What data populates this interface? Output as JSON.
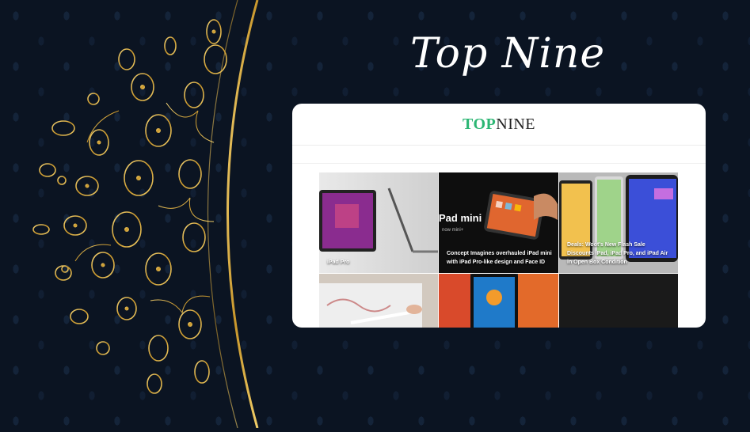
{
  "header": {
    "title": "Top Nine"
  },
  "site": {
    "logo_part1": "TOP",
    "logo_part2": "NINE"
  },
  "tiles": [
    {
      "caption": "iPad Pro",
      "bg": "#d9d9d9"
    },
    {
      "caption": "Concept Imagines overhauled iPad mini with iPad Pro-like design and Face ID",
      "overlay": "Pad mini",
      "overlay_sub": "now mini+",
      "bg": "#111111"
    },
    {
      "caption": "Deals: Woot's New Flash Sale Discounts iPad, iPad Pro, and iPad Air in Open Box Condition",
      "bg": "#f2c14e"
    },
    {
      "caption": "",
      "bg": "#cfc7bd"
    },
    {
      "caption": "",
      "bg": "#2a2a2a"
    },
    {
      "caption": "",
      "bg": "#1c1c1c"
    }
  ],
  "colors": {
    "background": "#0b1422",
    "gold": "#d4a937",
    "logo_green": "#2bb673"
  }
}
